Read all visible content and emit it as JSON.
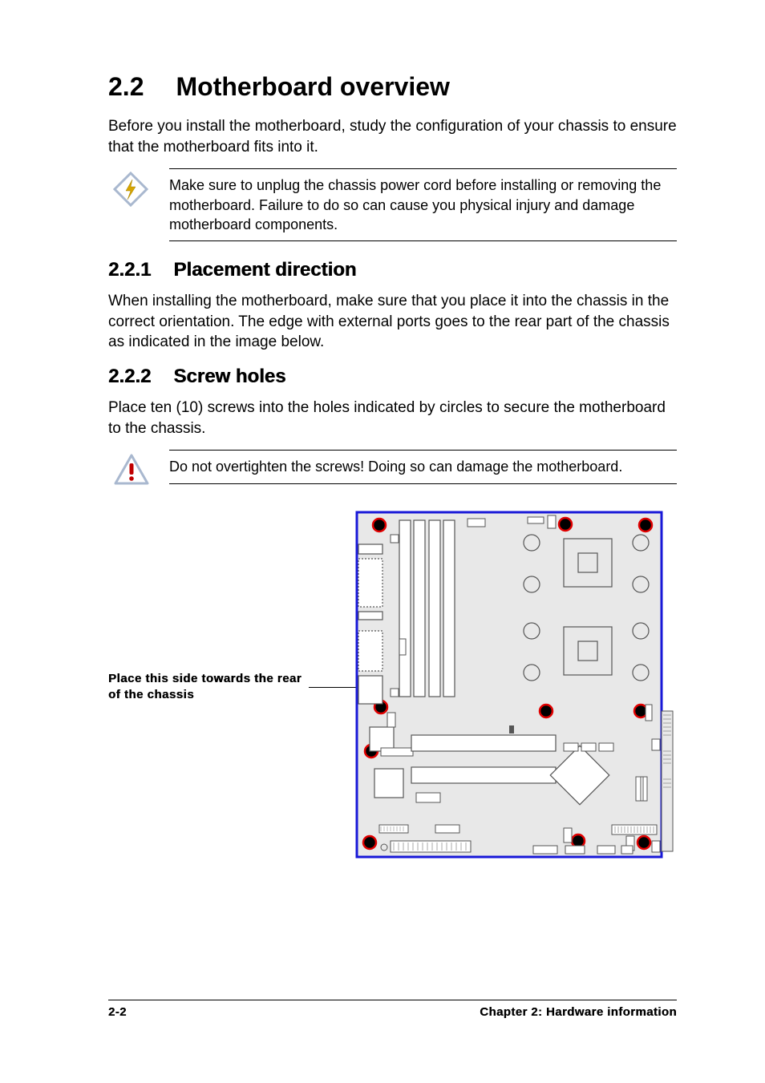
{
  "section": {
    "number": "2.2",
    "title": "Motherboard overview",
    "intro": "Before you install the motherboard, study the configuration of your chassis to ensure that the motherboard fits into it."
  },
  "callout_power": "Make sure to unplug the chassis power cord before installing or removing the motherboard. Failure to do so can cause you physical injury and damage motherboard components.",
  "sub1": {
    "number": "2.2.1",
    "title": "Placement direction",
    "body": "When installing the motherboard, make sure that you place it into the chassis in the correct orientation. The edge with external ports goes to the rear part of the chassis as indicated in the image below."
  },
  "sub2": {
    "number": "2.2.2",
    "title": "Screw holes",
    "body": "Place ten (10) screws into the holes indicated by circles to secure the motherboard to the chassis."
  },
  "callout_caution": "Do not overtighten the screws! Doing so can damage the motherboard.",
  "diagram_label": "Place this side towards the rear of the chassis",
  "footer": {
    "page": "2-2",
    "chapter": "Chapter 2: Hardware information"
  }
}
